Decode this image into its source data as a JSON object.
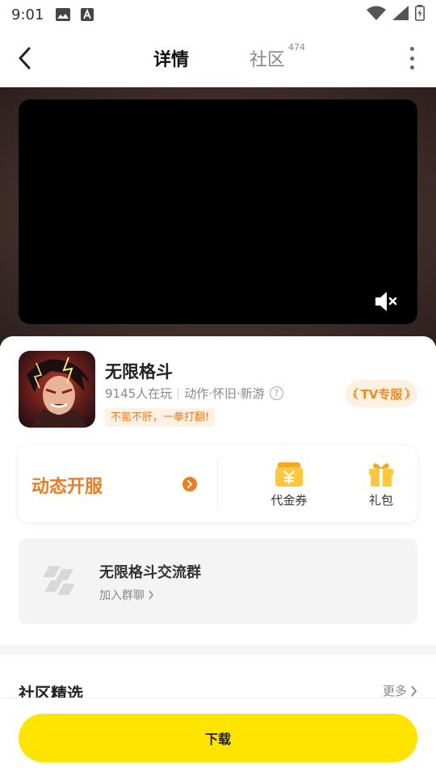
{
  "status_bar": {
    "time": "9:01",
    "icons": [
      "image-icon",
      "text-a-icon",
      "wifi-icon",
      "signal-icon",
      "battery-icon"
    ]
  },
  "header": {
    "tabs": [
      {
        "label": "详情",
        "active": true
      },
      {
        "label": "社区",
        "badge": "474",
        "active": false
      }
    ],
    "accent_color": "#ffe100"
  },
  "game": {
    "title": "无限格斗",
    "players": "9145人在玩",
    "tags": "动作·怀旧·新游",
    "help_glyph": "?",
    "tagline": "不氪不肝，一拳打翻!",
    "tv_badge": "TV专服"
  },
  "features": {
    "server_label": "动态开服",
    "coupon_label": "代金券",
    "gift_label": "礼包"
  },
  "group": {
    "name": "无限格斗交流群",
    "join_label": "加入群聊"
  },
  "community": {
    "section_title": "社区精选",
    "more_label": "更多"
  },
  "bottom": {
    "download_label": "下载"
  },
  "colors": {
    "orange": "#f27b1c",
    "yellow": "#ffe400"
  }
}
